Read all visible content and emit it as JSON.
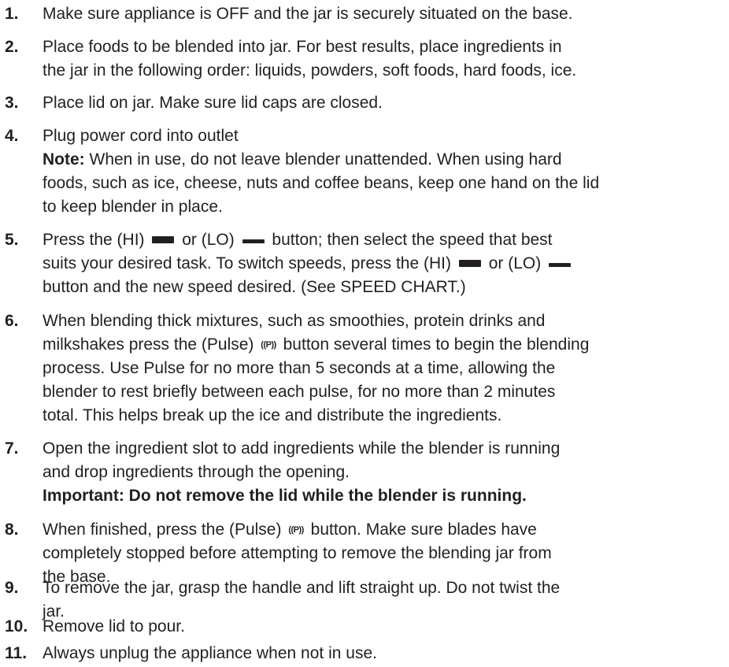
{
  "icons": {
    "hi": "hi-speed-bar-icon",
    "lo": "lo-speed-bar-icon",
    "pulse": "pulse-p-icon",
    "pulse_glyph": "((P))"
  },
  "steps": [
    {
      "num": "1.",
      "l1": "Make sure appliance is OFF and the jar is securely situated on the base."
    },
    {
      "num": "2.",
      "l1": "Place foods to be blended into jar. For best results, place ingredients in",
      "l2": "the jar in the following order: liquids, powders, soft foods, hard foods, ice."
    },
    {
      "num": "3.",
      "l1": "Place lid on jar. Make sure lid caps are closed."
    },
    {
      "num": "4.",
      "l1": "Plug power cord into outlet",
      "note_label": "Note:",
      "l2": " When in use, do not leave blender unattended. When using hard",
      "l3": "foods, such as ice, cheese, nuts and coffee beans, keep one hand on the lid",
      "l4": "to keep blender in place."
    },
    {
      "num": "5.",
      "l1a": "Press the  (HI)",
      "l1b": "or (LO)",
      "l1c": "button; then select the speed that best",
      "l2a": "suits your desired task. To switch speeds, press the  (HI)",
      "l2b": "or (LO)",
      "l3": "button and the new speed desired. (See SPEED CHART.)"
    },
    {
      "num": "6.",
      "l1": "When blending thick mixtures, such as smoothies, protein drinks and",
      "l2a": "milkshakes press the (Pulse)",
      "l2b": "button several times to begin the blending",
      "l3": "process. Use Pulse for no more than 5 seconds at a time, allowing the",
      "l4": "blender to rest briefly between each pulse, for no more than 2 minutes",
      "l5": "total. This helps break up the ice and distribute the ingredients."
    },
    {
      "num": "7.",
      "l1": "Open the ingredient slot to add ingredients while the blender is running",
      "l2": "and drop ingredients through the opening.",
      "l3": "Important: Do not remove the lid while the blender is running."
    },
    {
      "num": "8.",
      "l1a": "When finished, press the (Pulse)",
      "l1b": "button. Make sure blades have",
      "l2": "completely stopped before attempting to remove the blending jar from",
      "l3": "the base."
    },
    {
      "num": "9.",
      "l1": "To remove the jar, grasp the handle and lift straight up. Do not twist the",
      "l2": "jar."
    },
    {
      "num": "10.",
      "l1": "Remove lid to pour."
    },
    {
      "num": "11.",
      "l1": "Always unplug the appliance when not in use."
    }
  ]
}
